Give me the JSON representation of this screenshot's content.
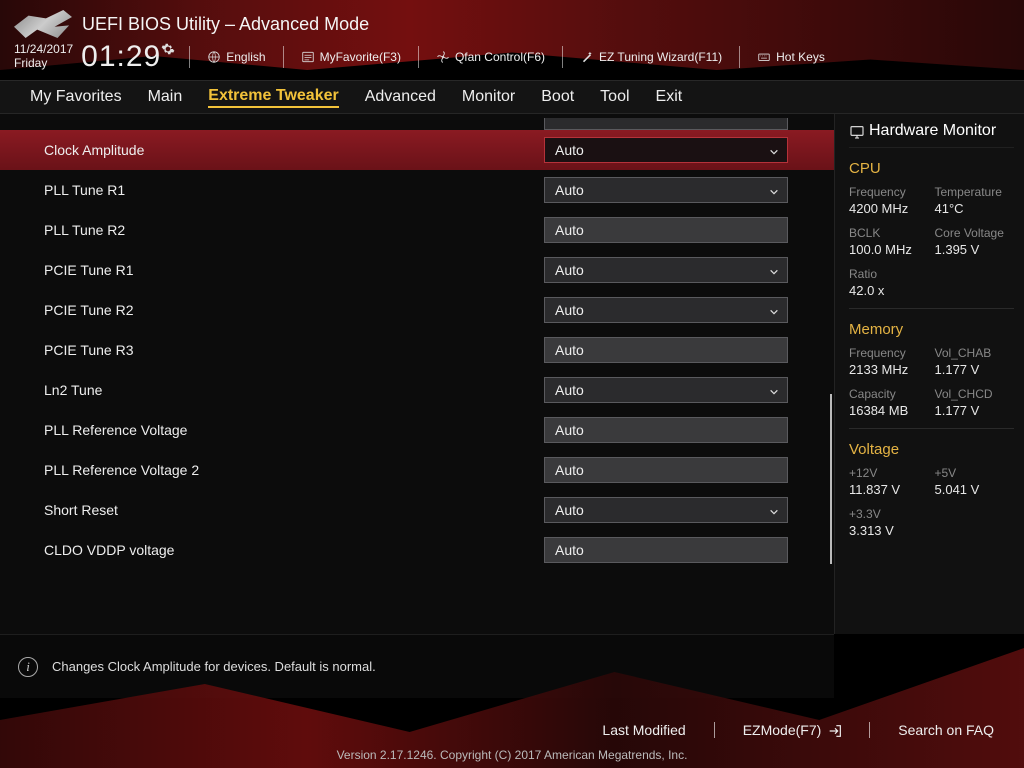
{
  "header": {
    "title": "UEFI BIOS Utility – Advanced Mode",
    "date": "11/24/2017",
    "day": "Friday",
    "time": "01:29",
    "toolbar": {
      "language": "English",
      "myfavorite": "MyFavorite(F3)",
      "qfan": "Qfan Control(F6)",
      "eztuning": "EZ Tuning Wizard(F11)",
      "hotkeys": "Hot Keys"
    }
  },
  "tabs": [
    "My Favorites",
    "Main",
    "Extreme Tweaker",
    "Advanced",
    "Monitor",
    "Boot",
    "Tool",
    "Exit"
  ],
  "active_tab": "Extreme Tweaker",
  "settings": [
    {
      "label": "Clock Amplitude",
      "value": "Auto",
      "dropdown": true,
      "selected": true
    },
    {
      "label": "PLL Tune R1",
      "value": "Auto",
      "dropdown": true
    },
    {
      "label": "PLL Tune R2",
      "value": "Auto",
      "dropdown": false
    },
    {
      "label": "PCIE Tune R1",
      "value": "Auto",
      "dropdown": true
    },
    {
      "label": "PCIE Tune R2",
      "value": "Auto",
      "dropdown": true
    },
    {
      "label": "PCIE Tune R3",
      "value": "Auto",
      "dropdown": false
    },
    {
      "label": "Ln2 Tune",
      "value": "Auto",
      "dropdown": true
    },
    {
      "label": "PLL Reference Voltage",
      "value": "Auto",
      "dropdown": false
    },
    {
      "label": "PLL Reference Voltage 2",
      "value": "Auto",
      "dropdown": false
    },
    {
      "label": "Short Reset",
      "value": "Auto",
      "dropdown": true
    },
    {
      "label": "CLDO VDDP voltage",
      "value": "Auto",
      "dropdown": false
    }
  ],
  "help_text": "Changes Clock Amplitude for devices. Default is normal.",
  "hwmon": {
    "title": "Hardware Monitor",
    "cpu": {
      "title": "CPU",
      "freq_lbl": "Frequency",
      "freq_val": "4200 MHz",
      "temp_lbl": "Temperature",
      "temp_val": "41°C",
      "bclk_lbl": "BCLK",
      "bclk_val": "100.0 MHz",
      "cv_lbl": "Core Voltage",
      "cv_val": "1.395 V",
      "ratio_lbl": "Ratio",
      "ratio_val": "42.0 x"
    },
    "mem": {
      "title": "Memory",
      "freq_lbl": "Frequency",
      "freq_val": "2133 MHz",
      "vchab_lbl": "Vol_CHAB",
      "vchab_val": "1.177 V",
      "cap_lbl": "Capacity",
      "cap_val": "16384 MB",
      "vchcd_lbl": "Vol_CHCD",
      "vchcd_val": "1.177 V"
    },
    "volt": {
      "title": "Voltage",
      "v12_lbl": "+12V",
      "v12_val": "11.837 V",
      "v5_lbl": "+5V",
      "v5_val": "5.041 V",
      "v33_lbl": "+3.3V",
      "v33_val": "3.313 V"
    }
  },
  "footer": {
    "last_modified": "Last Modified",
    "ezmode": "EZMode(F7)",
    "search": "Search on FAQ",
    "version": "Version 2.17.1246. Copyright (C) 2017 American Megatrends, Inc."
  }
}
